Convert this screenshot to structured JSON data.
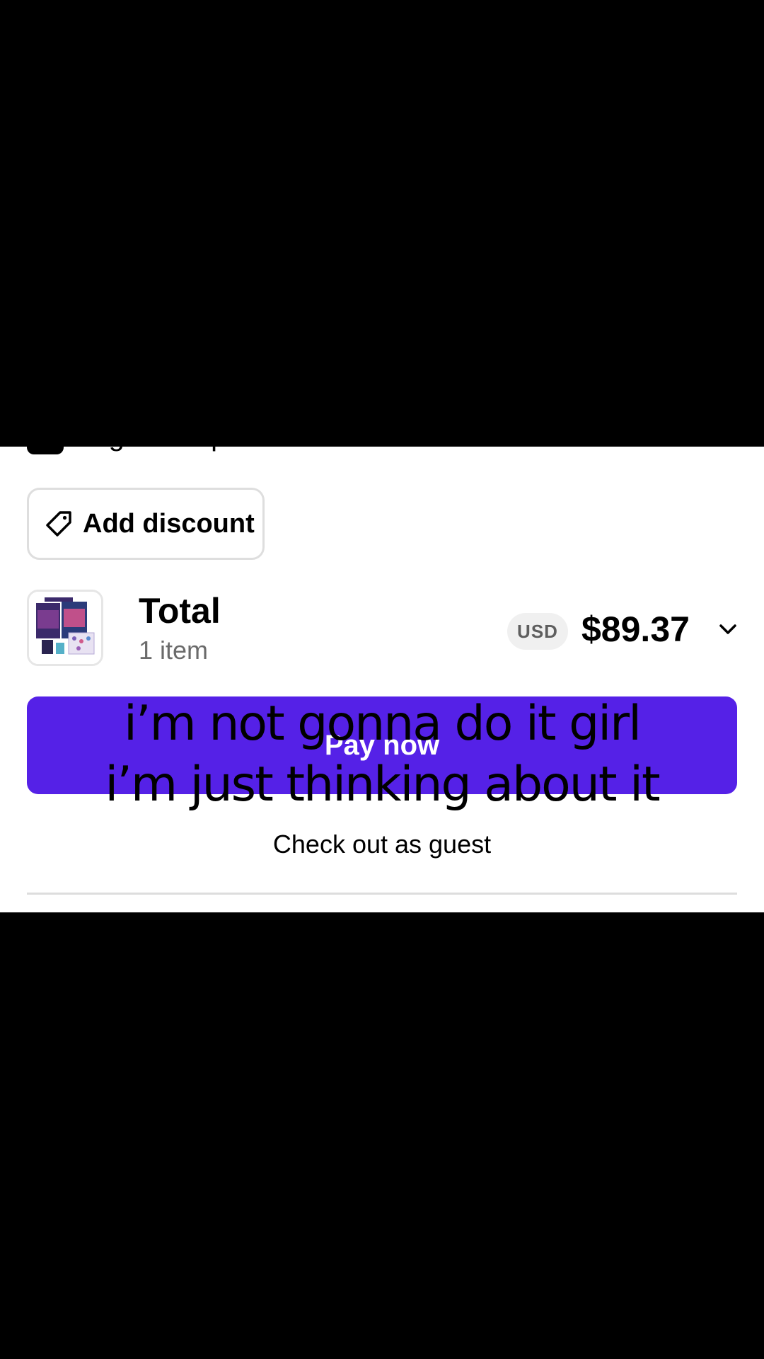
{
  "newsletter": {
    "label": "Sign me up for news and offers from this store",
    "checked": true
  },
  "discount": {
    "label": "Add discount",
    "icon": "tag-icon"
  },
  "summary": {
    "title": "Total",
    "item_count": "1 item",
    "currency": "USD",
    "amount": "$89.37",
    "expand_icon": "chevron-down-icon"
  },
  "actions": {
    "pay_label": "Pay now",
    "guest_label": "Check out as guest"
  },
  "caption": {
    "line1": "i’m not gonna do it girl",
    "line2": "i’m just thinking about it"
  },
  "colors": {
    "pay_button": "#5521e7",
    "background": "#ffffff",
    "letterbox": "#000000"
  }
}
